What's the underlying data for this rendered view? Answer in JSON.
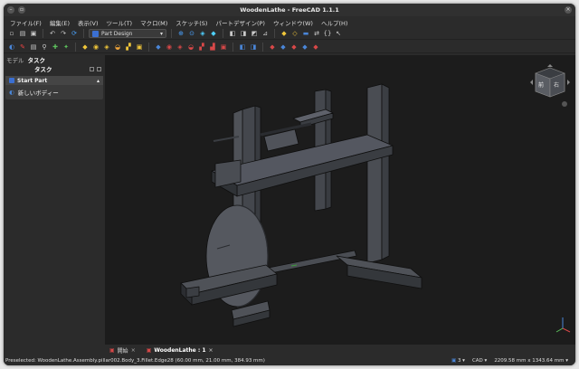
{
  "window": {
    "title": "WoodenLathe - FreeCAD 1.1.1"
  },
  "menu": [
    "ファイル(F)",
    "編集(E)",
    "表示(V)",
    "ツール(T)",
    "マクロ(M)",
    "スケッチ(S)",
    "パートデザイン(P)",
    "ウィンドウ(W)",
    "ヘルプ(H)"
  ],
  "workbench": {
    "selected": "Part Design"
  },
  "combo": {
    "tab_model": "モデル",
    "tab_task": "タスク"
  },
  "task_panel": {
    "title": "タスク",
    "section_title": "Start Part",
    "new_body_label": "新しいボディー"
  },
  "navcube": {
    "face_label": "前",
    "face_label2": "右"
  },
  "doc_tabs": {
    "start_label": "開始",
    "document_label": "WoodenLathe : 1"
  },
  "statusbar": {
    "preselection": "Preselected: WoodenLathe.Assembly.pillar002.Body_3.Fillet.Edge28 (60.00 mm, 21.00 mm, 384.93 mm)",
    "selection_count": "3",
    "nav_style": "CAD",
    "dimensions": "2209.58 mm x 1343.64 mm"
  },
  "colors": {
    "accent": "#3b6fd1",
    "viewport": "#1c1c1c",
    "model_face": "#4b4e54"
  }
}
